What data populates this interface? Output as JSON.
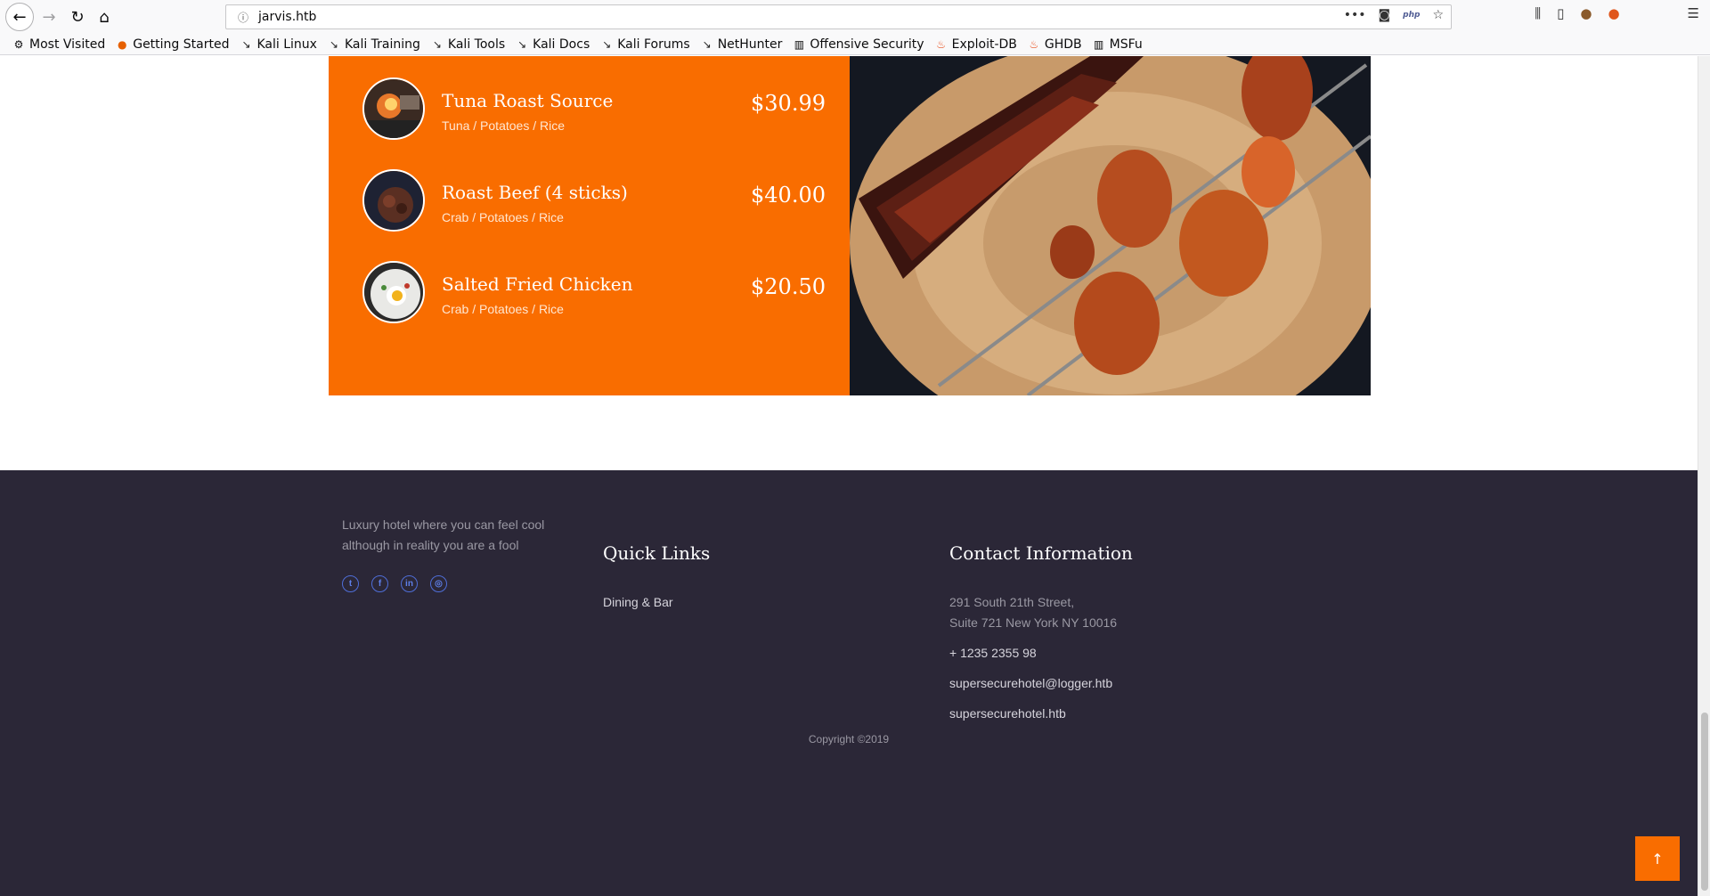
{
  "browser": {
    "url": "jarvis.htb",
    "bookmarks": [
      {
        "label": "Most Visited",
        "icon": "gear-icon"
      },
      {
        "label": "Getting Started",
        "icon": "firefox-icon"
      },
      {
        "label": "Kali Linux",
        "icon": "kali-icon"
      },
      {
        "label": "Kali Training",
        "icon": "kali-icon"
      },
      {
        "label": "Kali Tools",
        "icon": "kali-icon"
      },
      {
        "label": "Kali Docs",
        "icon": "kali-icon"
      },
      {
        "label": "Kali Forums",
        "icon": "kali-icon"
      },
      {
        "label": "NetHunter",
        "icon": "kali-icon"
      },
      {
        "label": "Offensive Security",
        "icon": "offsec-icon"
      },
      {
        "label": "Exploit-DB",
        "icon": "exploitdb-icon"
      },
      {
        "label": "GHDB",
        "icon": "exploitdb-icon"
      },
      {
        "label": "MSFu",
        "icon": "offsec-icon"
      }
    ],
    "php_badge": "php"
  },
  "menu": {
    "accent_color": "#f96d00",
    "items": [
      {
        "name": "Tuna Roast Source",
        "desc": "Tuna / Potatoes / Rice",
        "price": "$30.99"
      },
      {
        "name": "Roast Beef (4 sticks)",
        "desc": "Crab / Potatoes / Rice",
        "price": "$40.00"
      },
      {
        "name": "Salted Fried Chicken",
        "desc": "Crab / Potatoes / Rice",
        "price": "$20.50"
      }
    ]
  },
  "footer": {
    "background": "#2b2737",
    "about": "Luxury hotel where you can feel cool although in reality you are a fool",
    "social": [
      "twitter-icon",
      "facebook-icon",
      "linkedin-icon",
      "dribbble-icon"
    ],
    "quick_links_title": "Quick Links",
    "quick_links": [
      "Dining & Bar"
    ],
    "contact_title": "Contact Information",
    "address_line1": "291 South 21th Street,",
    "address_line2": "Suite 721 New York NY 10016",
    "phone": "+ 1235 2355 98",
    "email": "supersecurehotel@logger.htb",
    "website": "supersecurehotel.htb",
    "copyright": "Copyright ©2019"
  }
}
